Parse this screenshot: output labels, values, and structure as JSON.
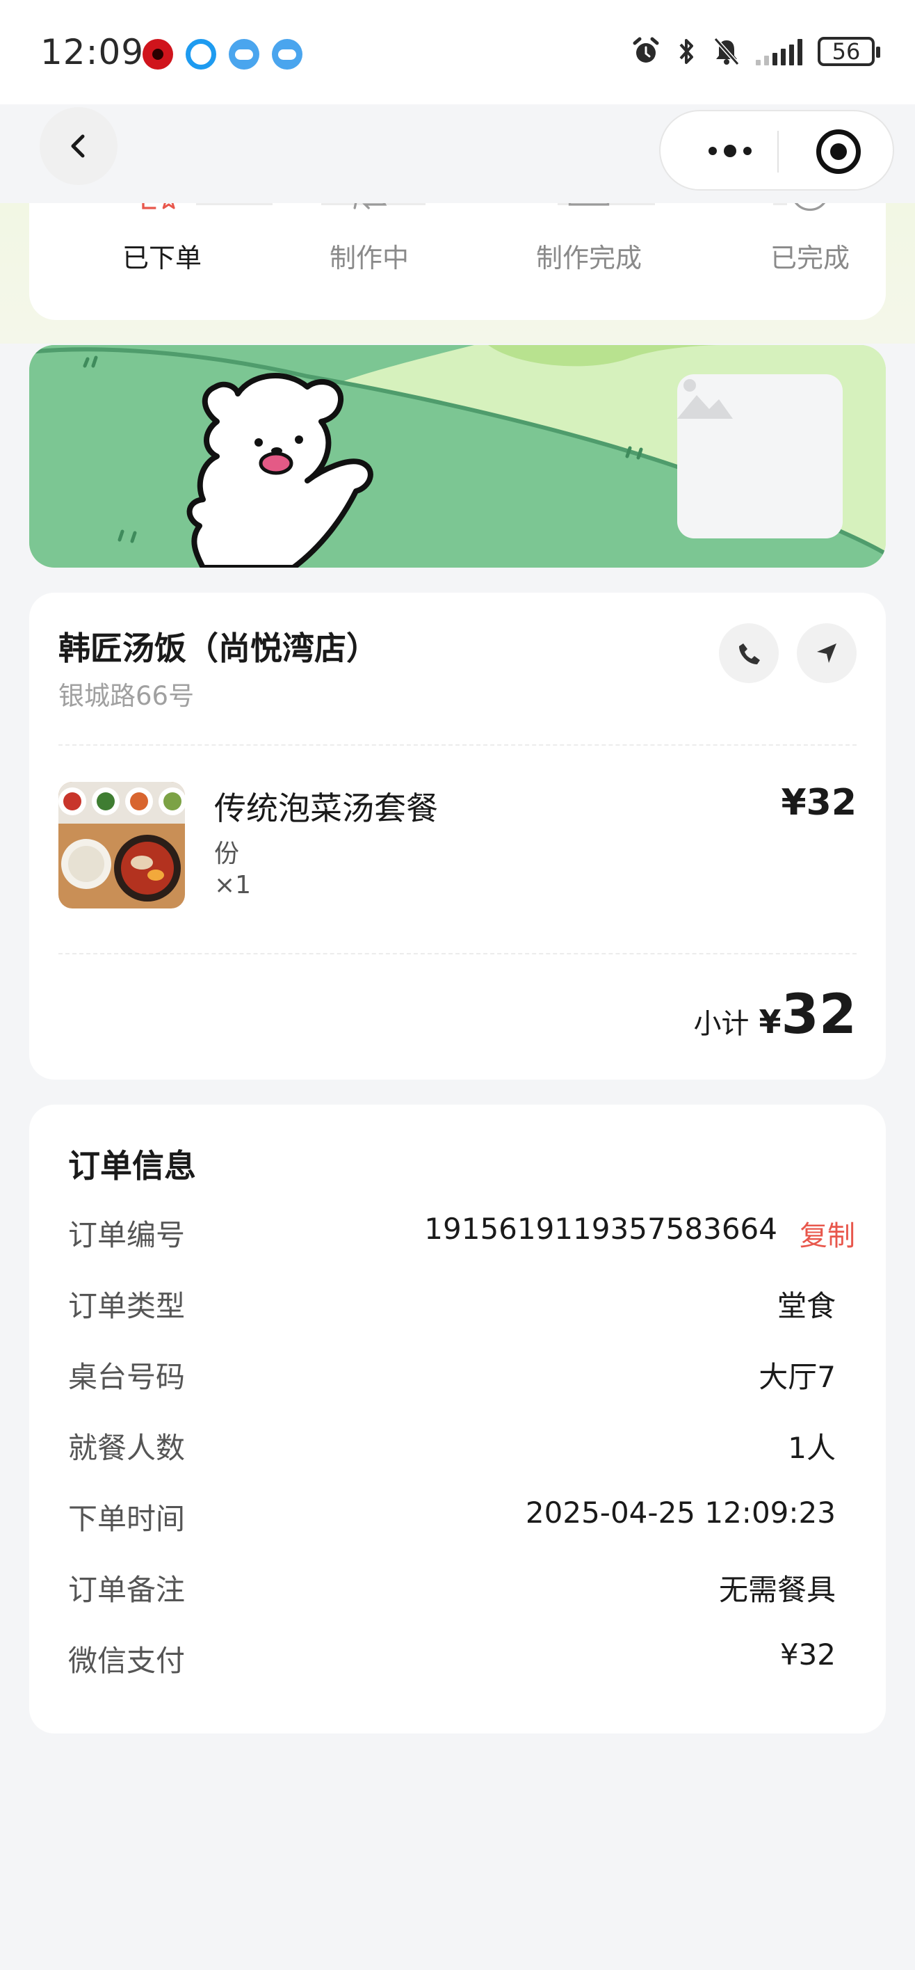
{
  "status_bar": {
    "time": "12:09",
    "battery": "56",
    "icons": [
      "netease-music-icon",
      "circle-app-icon",
      "cloud-app-icon",
      "cloud-app-icon",
      "alarm-icon",
      "bluetooth-icon",
      "mute-icon",
      "signal-icon",
      "battery-icon"
    ]
  },
  "nav": {
    "back_icon": "chevron-left-icon",
    "more_icon": "more-dots-icon",
    "target_icon": "target-icon"
  },
  "progress": {
    "steps": [
      {
        "label": "已下单",
        "active": true
      },
      {
        "label": "制作中",
        "active": false
      },
      {
        "label": "制作完成",
        "active": false
      },
      {
        "label": "已完成",
        "active": false
      }
    ],
    "accent": "#e8574c"
  },
  "banner": {
    "illustration": "white-bear-on-green-hill",
    "placeholder_icon": "image-placeholder-icon"
  },
  "store": {
    "name": "韩匠汤饭（尚悦湾店）",
    "address": "银城路66号",
    "phone_icon": "phone-icon",
    "navigate_icon": "navigation-arrow-icon"
  },
  "items": [
    {
      "name": "传统泡菜汤套餐",
      "unit": "份",
      "qty": "×1",
      "price": "¥32"
    }
  ],
  "subtotal": {
    "label": "小计",
    "currency": "¥",
    "value": "32"
  },
  "order_info": {
    "title": "订单信息",
    "order_number": {
      "label": "订单编号",
      "value": "1915619119357583664",
      "copy": "复制"
    },
    "order_type": {
      "label": "订单类型",
      "value": "堂食"
    },
    "table_number": {
      "label": "桌台号码",
      "value": "大厅7"
    },
    "diners": {
      "label": "就餐人数",
      "value": "1人"
    },
    "order_time": {
      "label": "下单时间",
      "value": "2025-04-25 12:09:23"
    },
    "remark": {
      "label": "订单备注",
      "value": "无需餐具"
    },
    "payment": {
      "label": "微信支付",
      "value": "¥32"
    }
  },
  "colors": {
    "accent_red": "#e8574c",
    "page_bg": "#f4f5f7",
    "banner_green": "#7cc693"
  }
}
